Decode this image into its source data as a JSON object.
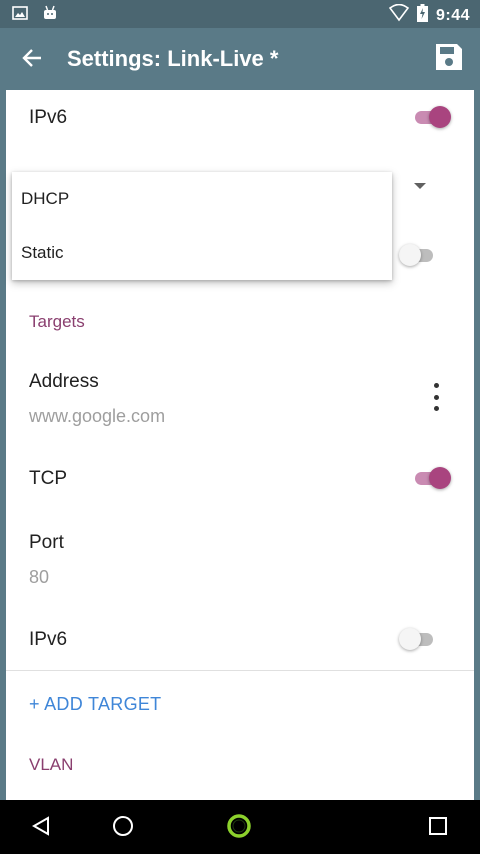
{
  "status_bar": {
    "time": "9:44",
    "icons": [
      "image-icon",
      "android-icon",
      "wifi-icon",
      "battery-charging-icon"
    ]
  },
  "app_bar": {
    "title": "Settings: Link-Live *",
    "back_icon": "arrow-back-icon",
    "save_icon": "save-icon"
  },
  "settings": {
    "ipv6_top": {
      "label": "IPv6",
      "enabled": true
    },
    "targets_header": "Targets",
    "target": {
      "address_label": "Address",
      "address_value": "www.google.com",
      "tcp_label": "TCP",
      "tcp_enabled": true,
      "port_label": "Port",
      "port_value": "80",
      "ipv6_label": "IPv6",
      "ipv6_enabled": false
    },
    "add_target": "+ ADD TARGET",
    "vlan_header": "VLAN"
  },
  "popup_menu": {
    "options": [
      "DHCP",
      "Static"
    ]
  },
  "nav_bar": {
    "icons": [
      "back-triangle-icon",
      "home-circle-icon",
      "app-ring-icon",
      "recents-square-icon"
    ]
  },
  "colors": {
    "primary": "#5a7a87",
    "status_bar": "#4b6671",
    "accent": "#a9447f",
    "section_header": "#8a3f6f",
    "link": "#3f86d8"
  }
}
